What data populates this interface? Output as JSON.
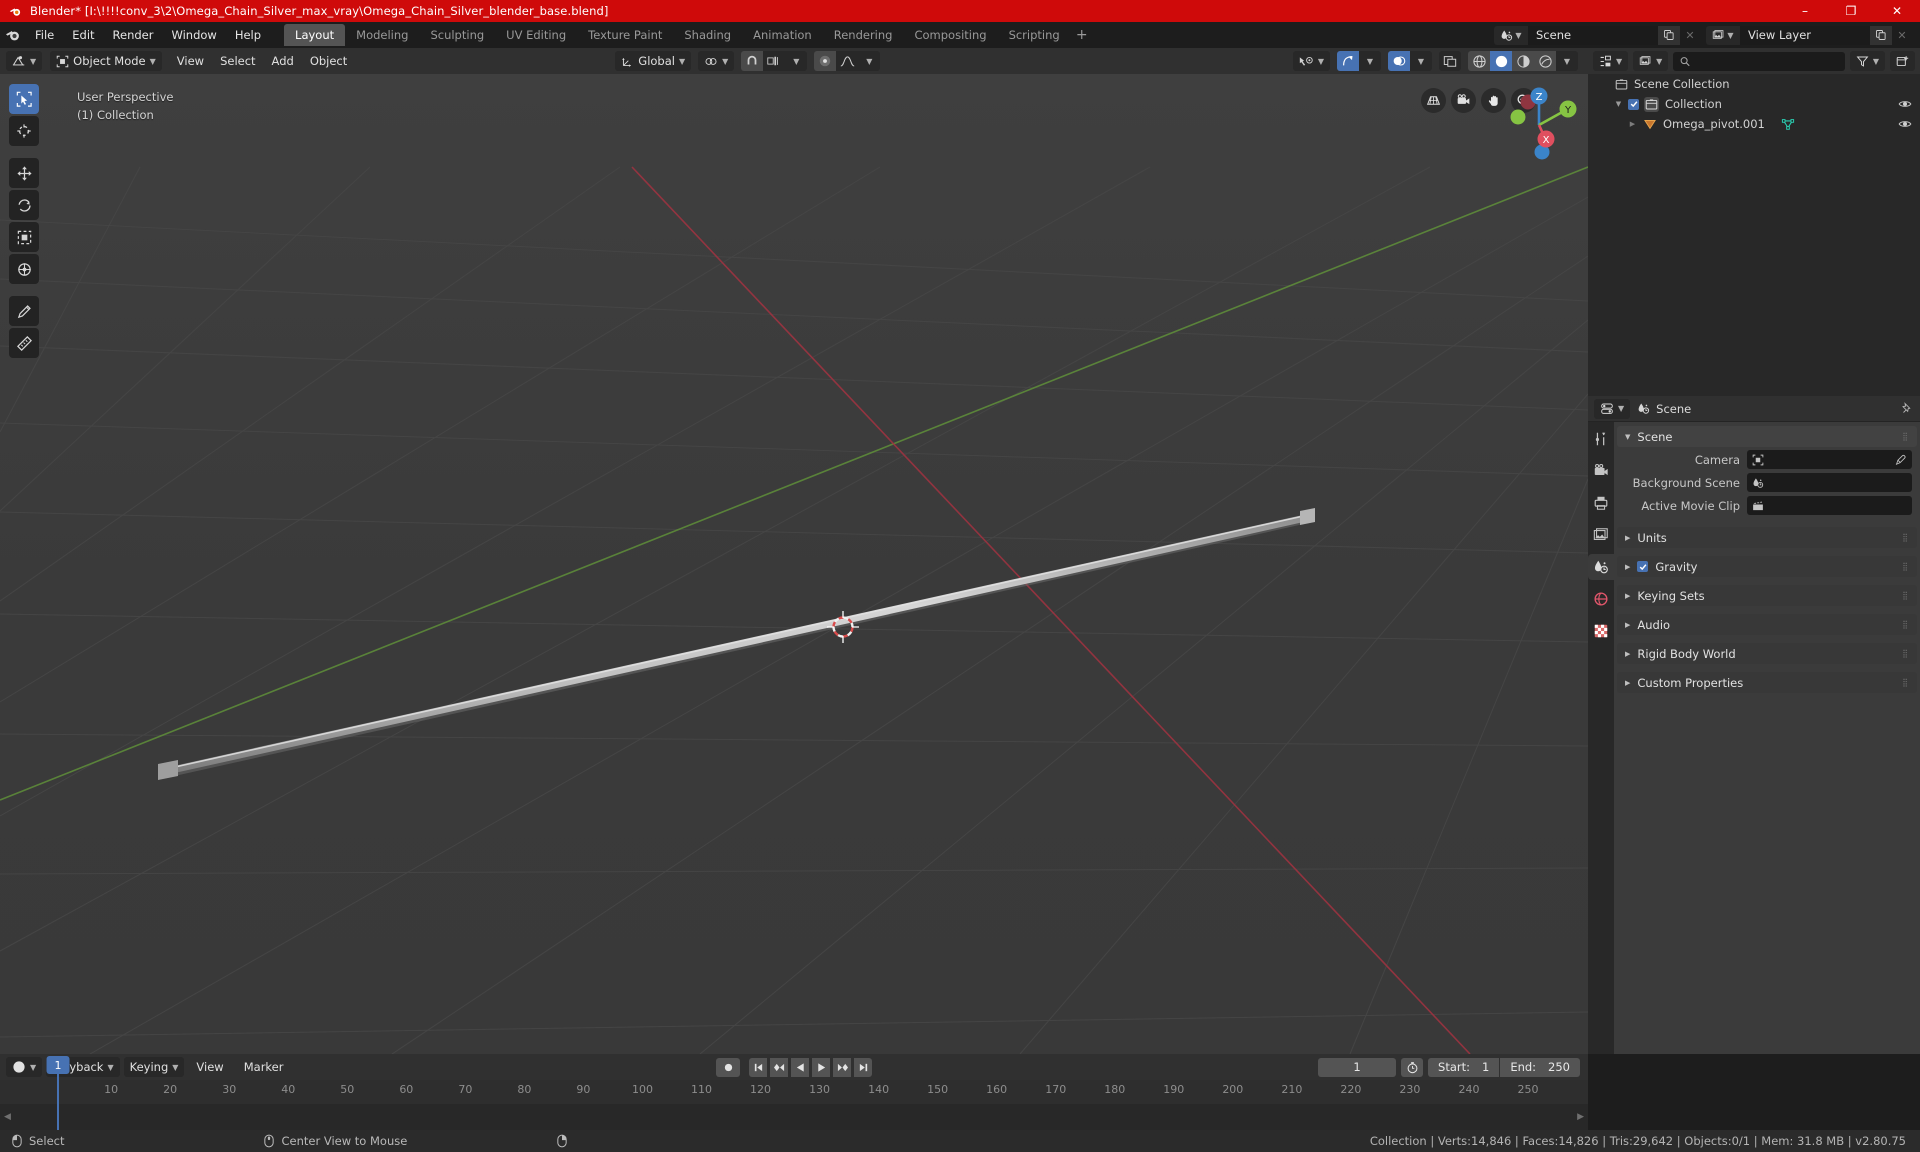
{
  "window": {
    "title": "Blender* [I:\\!!!!conv_3\\2\\Omega_Chain_Silver_max_vray\\Omega_Chain_Silver_blender_base.blend]",
    "minimize": "–",
    "maximize": "❐",
    "close": "✕"
  },
  "topbar": {
    "menus": [
      "File",
      "Edit",
      "Render",
      "Window",
      "Help"
    ],
    "workspaces": [
      {
        "label": "Layout",
        "active": true
      },
      {
        "label": "Modeling",
        "active": false
      },
      {
        "label": "Sculpting",
        "active": false
      },
      {
        "label": "UV Editing",
        "active": false
      },
      {
        "label": "Texture Paint",
        "active": false
      },
      {
        "label": "Shading",
        "active": false
      },
      {
        "label": "Animation",
        "active": false
      },
      {
        "label": "Rendering",
        "active": false
      },
      {
        "label": "Compositing",
        "active": false
      },
      {
        "label": "Scripting",
        "active": false
      }
    ],
    "add_workspace": "+",
    "scene_name": "Scene",
    "view_layer_name": "View Layer"
  },
  "viewport_header": {
    "mode": "Object Mode",
    "menus": [
      "View",
      "Select",
      "Add",
      "Object"
    ],
    "transform_orientation": "Global"
  },
  "viewport": {
    "perspective_label": "User Perspective",
    "collection_label": "(1) Collection",
    "gizmo": {
      "x": "X",
      "y": "Y",
      "z": "Z"
    }
  },
  "outliner": {
    "search_placeholder": "",
    "rows": [
      {
        "label": "Scene Collection",
        "indent": 0,
        "icon": "collection-icon",
        "has_disclosure": false,
        "has_checkbox": false,
        "has_eye": false
      },
      {
        "label": "Collection",
        "indent": 1,
        "icon": "collection-icon",
        "has_disclosure": true,
        "has_checkbox": true,
        "has_eye": true
      },
      {
        "label": "Omega_pivot.001",
        "indent": 2,
        "icon": "empty-arrows-icon",
        "has_disclosure": true,
        "has_checkbox": false,
        "has_eye": true,
        "data_icon": "mesh-data-icon"
      }
    ]
  },
  "properties": {
    "breadcrumb": "Scene",
    "panels": [
      {
        "label": "Scene",
        "open": true,
        "checkbox": false
      },
      {
        "label": "Units",
        "open": false,
        "checkbox": false
      },
      {
        "label": "Gravity",
        "open": false,
        "checkbox": true
      },
      {
        "label": "Keying Sets",
        "open": false,
        "checkbox": false
      },
      {
        "label": "Audio",
        "open": false,
        "checkbox": false
      },
      {
        "label": "Rigid Body World",
        "open": false,
        "checkbox": false
      },
      {
        "label": "Custom Properties",
        "open": false,
        "checkbox": false
      }
    ],
    "fields": [
      {
        "label": "Camera",
        "value": "",
        "icon": "camera-data-icon",
        "eyedropper": true
      },
      {
        "label": "Background Scene",
        "value": "",
        "icon": "scene-icon",
        "eyedropper": false
      },
      {
        "label": "Active Movie Clip",
        "value": "",
        "icon": "clip-icon",
        "eyedropper": false
      }
    ]
  },
  "timeline": {
    "menus": [
      "Playback",
      "Keying",
      "View",
      "Marker"
    ],
    "current_frame": "1",
    "start_label": "Start:",
    "start_value": "1",
    "end_label": "End:",
    "end_value": "250",
    "ticks": [
      "10",
      "20",
      "30",
      "40",
      "50",
      "60",
      "70",
      "80",
      "90",
      "100",
      "110",
      "120",
      "130",
      "140",
      "150",
      "160",
      "170",
      "180",
      "190",
      "200",
      "210",
      "220",
      "230",
      "240",
      "250"
    ],
    "playhead_frame": "1"
  },
  "statusbar": {
    "mouse_left_label": "Select",
    "mouse_mid_label": "Center View to Mouse",
    "stats": "Collection | Verts:14,846 | Faces:14,826 | Tris:29,642 | Objects:0/1 | Mem: 31.8 MB | v2.80.75"
  },
  "colors": {
    "title_bar": "#cf0a0a",
    "accent_blue": "#4772b3",
    "axis_x_red": "#e04f5f",
    "axis_y_green": "#86c443",
    "axis_z_blue": "#3b84c9",
    "viewport_bg": "#3b3b3b"
  }
}
